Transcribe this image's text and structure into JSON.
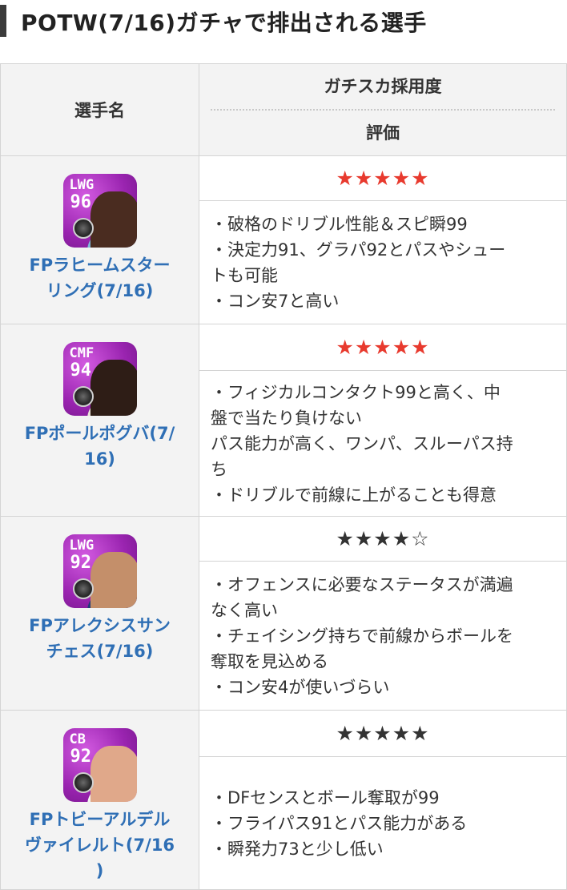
{
  "heading": "POTW(7/16)ガチャで排出される選手",
  "table": {
    "col_name": "選手名",
    "col_usage": "ガチスカ採用度",
    "col_rating": "評価"
  },
  "players": [
    {
      "position": "LWG",
      "rating_value": "96",
      "name_line1": "FPラヒームスター",
      "name_line2": "リング(7/16)",
      "name_line3": "",
      "stars": "★★★★★",
      "star_color": "#e83a2e",
      "desc": [
        "・破格のドリブル性能＆スピ瞬99",
        "・決定力91、グラパ92とパスやシュー",
        "トも可能",
        "・コン安7と高い"
      ]
    },
    {
      "position": "CMF",
      "rating_value": "94",
      "name_line1": "FPポールポグバ(7/",
      "name_line2": "16)",
      "name_line3": "",
      "stars": "★★★★★",
      "star_color": "#e83a2e",
      "desc": [
        "・フィジカルコンタクト99と高く、中",
        "盤で当たり負けない",
        "パス能力が高く、ワンパ、スルーパス持",
        "ち",
        "・ドリブルで前線に上がることも得意"
      ]
    },
    {
      "position": "LWG",
      "rating_value": "92",
      "name_line1": "FPアレクシスサン",
      "name_line2": "チェス(7/16)",
      "name_line3": "",
      "stars": "★★★★☆",
      "star_color": "#333333",
      "desc": [
        "・オフェンスに必要なステータスが満遍",
        "なく高い",
        "・チェイシング持ちで前線からボールを",
        "奪取を見込める",
        "・コン安4が使いづらい"
      ]
    },
    {
      "position": "CB",
      "rating_value": "92",
      "name_line1": "FPトビーアルデル",
      "name_line2": "ヴァイレルト(7/16",
      "name_line3": ")",
      "stars": "★★★★★",
      "star_color": "#333333",
      "desc": [
        "・DFセンスとボール奪取が99",
        "・フライパス91とパス能力がある",
        "・瞬発力73と少し低い"
      ]
    }
  ]
}
